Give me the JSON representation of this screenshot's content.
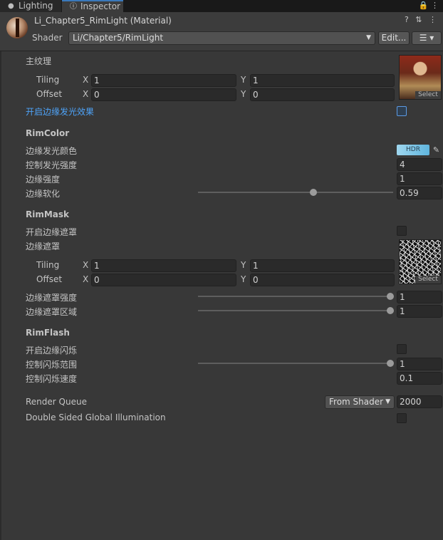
{
  "tabs": {
    "lighting": {
      "label": "Lighting",
      "icon": "lightbulb-icon"
    },
    "inspector": {
      "label": "Inspector",
      "icon": "info-icon"
    },
    "menu_icons": "🔒 ⋮"
  },
  "header": {
    "title": "Li_Chapter5_RimLight (Material)",
    "shader_label": "Shader",
    "shader_value": "Li/Chapter5/RimLight",
    "edit_button": "Edit...",
    "icons": "? ⇅ ⋮",
    "list_button": "☰ ▾"
  },
  "main_texture": {
    "label": "主纹理",
    "tiling_label": "Tiling",
    "offset_label": "Offset",
    "x_label": "X",
    "y_label": "Y",
    "tiling_x": "1",
    "tiling_y": "1",
    "offset_x": "0",
    "offset_y": "0",
    "select_label": "Select"
  },
  "rim_toggle": {
    "label": "开启边缘发光效果",
    "checked": false
  },
  "rim_color": {
    "section": "RimColor",
    "color_label": "边缘发光颜色",
    "hdr_label": "HDR",
    "intensity_label": "控制发光强度",
    "intensity_value": "4",
    "strength_label": "边缘强度",
    "strength_value": "1",
    "softness_label": "边缘软化",
    "softness_value": "0.59",
    "softness_fraction": 0.59
  },
  "rim_mask": {
    "section": "RimMask",
    "toggle_label": "开启边缘遮罩",
    "mask_label": "边缘遮罩",
    "tiling_label": "Tiling",
    "offset_label": "Offset",
    "x_label": "X",
    "y_label": "Y",
    "tiling_x": "1",
    "tiling_y": "1",
    "offset_x": "0",
    "offset_y": "0",
    "select_label": "Select",
    "mask_strength_label": "边缘遮罩强度",
    "mask_strength_value": "1",
    "mask_area_label": "边缘遮罩区域",
    "mask_area_value": "1"
  },
  "rim_flash": {
    "section": "RimFlash",
    "toggle_label": "开启边缘闪烁",
    "range_label": "控制闪烁范围",
    "range_value": "1",
    "speed_label": "控制闪烁速度",
    "speed_value": "0.1"
  },
  "render": {
    "queue_label": "Render Queue",
    "queue_mode": "From Shader",
    "queue_value": "2000",
    "double_sided_label": "Double Sided Global Illumination"
  },
  "colors": {
    "background": "#383838",
    "accent_blue": "#4ea3f8",
    "hdr_cyan": "#7ec6e8"
  }
}
